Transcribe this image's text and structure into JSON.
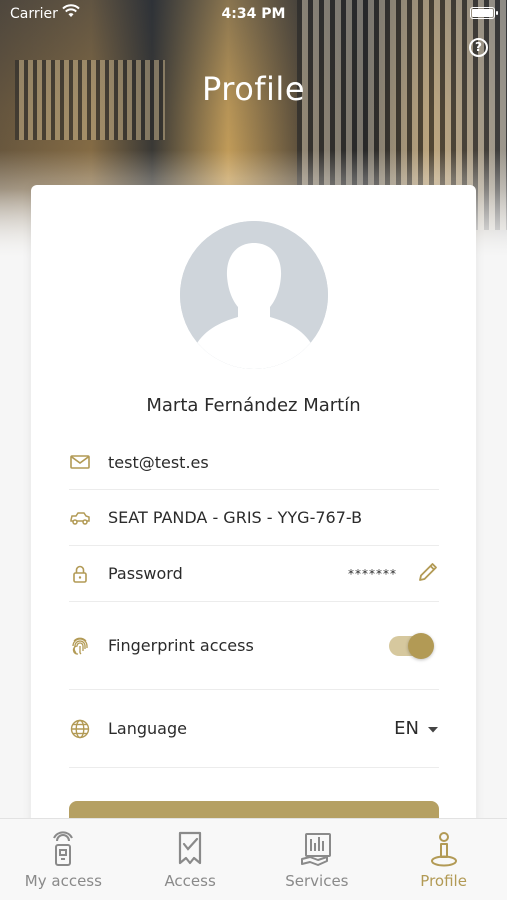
{
  "status_bar": {
    "carrier": "Carrier",
    "time": "4:34 PM"
  },
  "header": {
    "title": "Profile",
    "help_icon": "question-circle-icon"
  },
  "profile": {
    "name": "Marta Fernández Martín",
    "rows": [
      {
        "icon": "envelope-icon",
        "label": "test@test.es"
      },
      {
        "icon": "car-icon",
        "label": "SEAT PANDA - GRIS - YYG-767-B"
      },
      {
        "icon": "lock-icon",
        "label": "Password",
        "value": "*******",
        "action_icon": "pencil-icon"
      },
      {
        "icon": "fingerprint-icon",
        "label": "Fingerprint access",
        "toggle_on": true
      },
      {
        "icon": "globe-icon",
        "label": "Language",
        "value": "EN",
        "action_icon": "caret-down-icon"
      }
    ]
  },
  "tabs": [
    {
      "label": "My access",
      "icon": "key-card-icon",
      "active": false
    },
    {
      "label": "Access",
      "icon": "checklist-icon",
      "active": false
    },
    {
      "label": "Services",
      "icon": "services-icon",
      "active": false
    },
    {
      "label": "Profile",
      "icon": "profile-pin-icon",
      "active": true
    }
  ],
  "colors": {
    "accent": "#b29a55",
    "tab_inactive": "#8a8a8a"
  }
}
